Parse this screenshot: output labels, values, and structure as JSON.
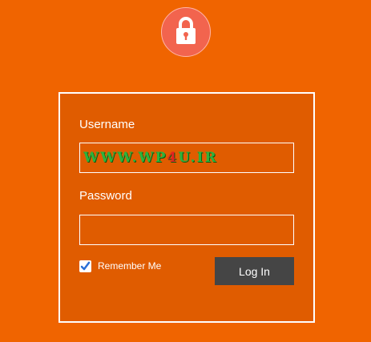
{
  "colors": {
    "background": "#f06400",
    "panel": "#e05c00",
    "logo_circle": "#f2644e",
    "button": "#454545",
    "watermark_green": "#2db33d",
    "watermark_red": "#e42222"
  },
  "logo": {
    "icon": "lock-icon"
  },
  "form": {
    "username_label": "Username",
    "username_value_prefix": "WWW.WP",
    "username_value_highlight": "4",
    "username_value_suffix": "U.IR",
    "password_label": "Password",
    "password_value": "",
    "remember_label": "Remember Me",
    "remember_checked": true,
    "login_label": "Log In"
  }
}
